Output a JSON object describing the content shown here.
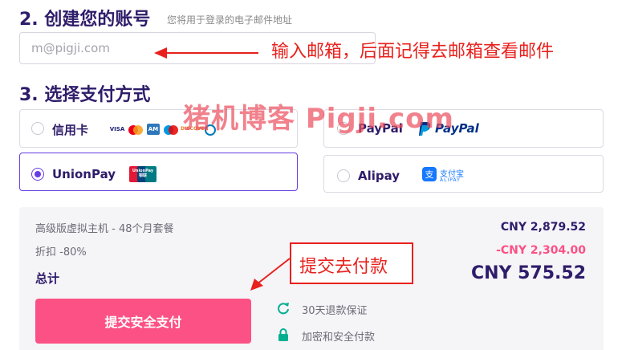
{
  "account": {
    "title": "2. 创建您的账号",
    "subtitle": "您将用于登录的电子邮件地址",
    "email_placeholder": "m@pigji.com"
  },
  "annotations": {
    "email_note": "输入邮箱，后面记得去邮箱查看邮件",
    "submit_note": "提交去付款",
    "watermark": "猪机博客 Pigji.com",
    "color": "#e8211d"
  },
  "payment": {
    "title": "3. 选择支付方式",
    "options": [
      {
        "label": "信用卡",
        "selected": false,
        "logos": [
          "VISA",
          "Mastercard",
          "American Express",
          "Maestro",
          "Discover",
          "Diners Club"
        ]
      },
      {
        "label": "PayPal",
        "selected": false,
        "brand": "PayPal",
        "brand_color": "#003087"
      },
      {
        "label": "UnionPay",
        "selected": true,
        "brand": "UnionPay 银联"
      },
      {
        "label": "Alipay",
        "selected": false,
        "brand": "支付宝",
        "brand_sub": "ALIPAY",
        "brand_color": "#1677ff"
      }
    ]
  },
  "summary": {
    "plan_label": "高级版虚拟主机 - 48个月套餐",
    "plan_price": "CNY 2,879.52",
    "discount_label": "折扣 -80%",
    "discount_value": "-CNY 2,304.00",
    "total_label": "总计",
    "total_value": "CNY 575.52",
    "submit_label": "提交安全支付",
    "features": [
      {
        "icon": "refresh-icon",
        "text": "30天退款保证"
      },
      {
        "icon": "lock-icon",
        "text": "加密和安全付款"
      }
    ]
  },
  "colors": {
    "accent": "#673de6",
    "primary_button": "#fc5185",
    "text": "#2f1c6a"
  }
}
